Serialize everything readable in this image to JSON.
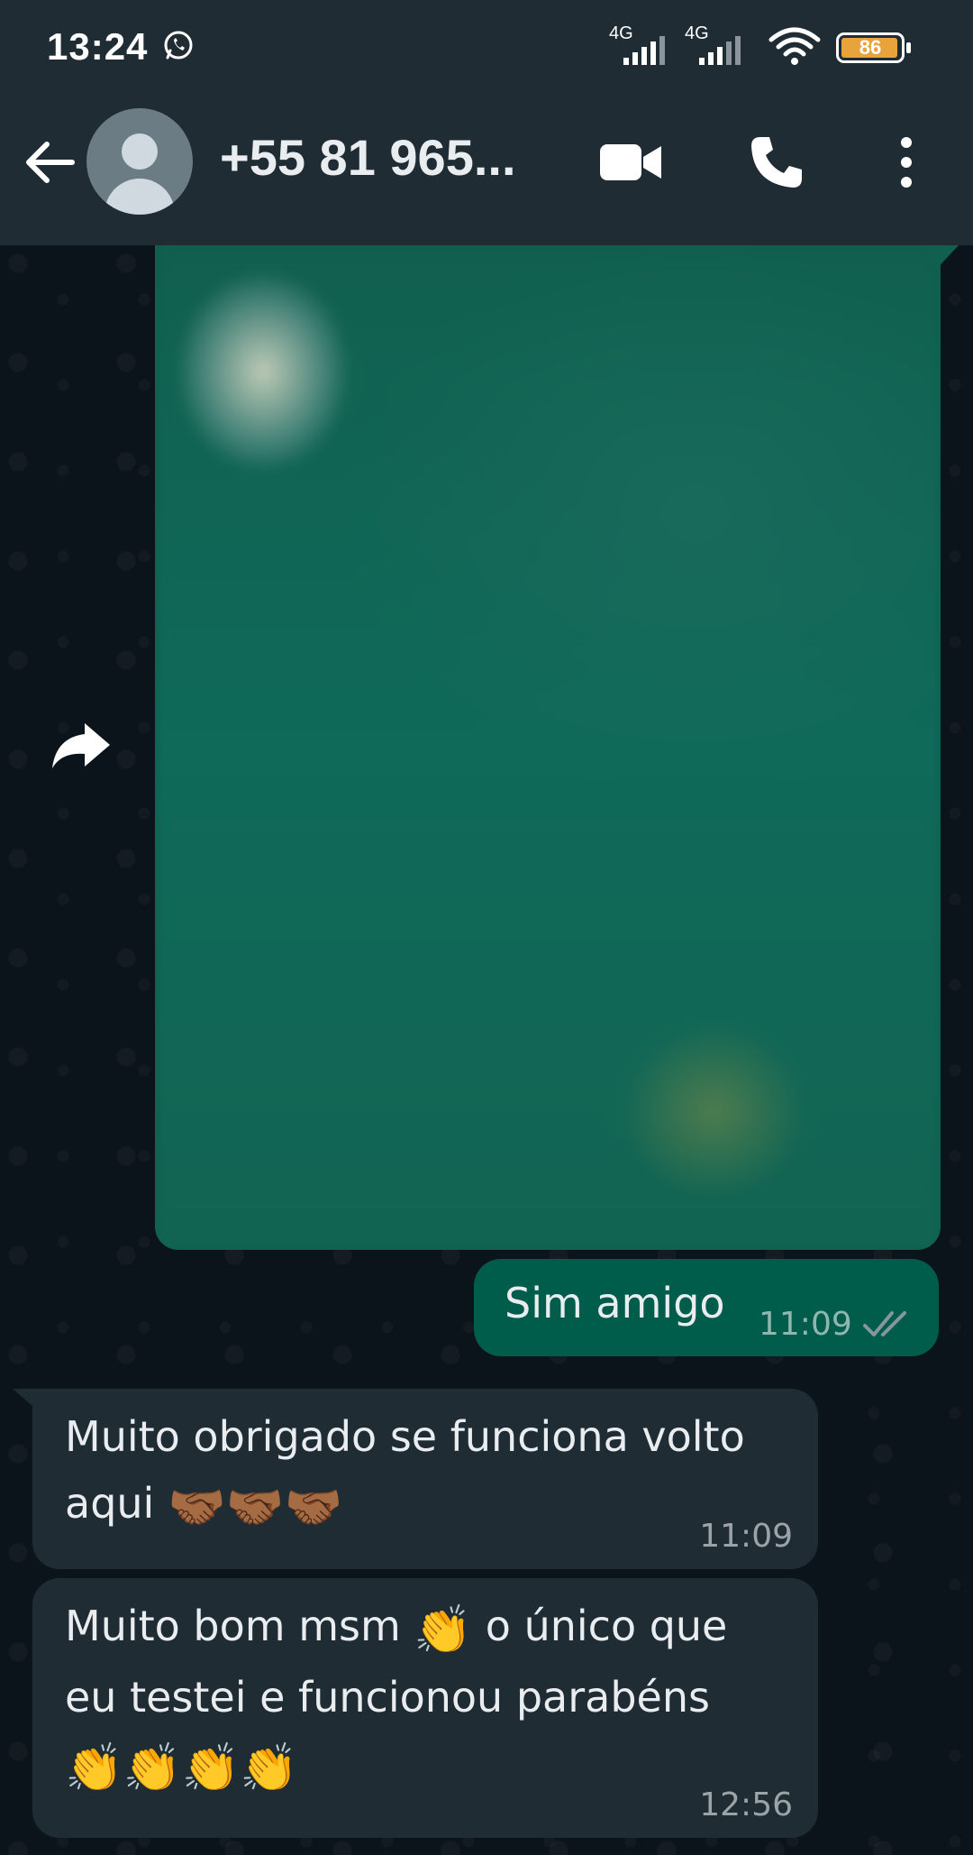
{
  "status_bar": {
    "time": "13:24",
    "signal1_label": "4G",
    "signal2_label": "4G",
    "battery_level": "86"
  },
  "header": {
    "contact_name": "+55 81 965..."
  },
  "messages": [
    {
      "type": "image",
      "direction": "outgoing"
    },
    {
      "type": "text",
      "direction": "outgoing",
      "text": "Sim amigo",
      "time": "11:09",
      "status": "read"
    },
    {
      "type": "text",
      "direction": "incoming",
      "text_line1": "Muito obrigado se funciona volto",
      "text_line2": "aqui",
      "emojis": "🤝🏾🤝🏾🤝🏾",
      "time": "11:09"
    },
    {
      "type": "text",
      "direction": "incoming",
      "text_part1": "Muito bom msm",
      "emoji1": "👏",
      "text_part2": "o único que",
      "text_line2": "eu testei e funcionou parabéns",
      "emojis_line3": "👏👏👏👏",
      "time": "12:56"
    }
  ],
  "colors": {
    "header_bg": "#1f2c34",
    "chat_bg": "#0b141a",
    "outgoing_bubble": "#005c4b",
    "incoming_bubble": "#1f2c34",
    "read_ticks": "#8696a0"
  }
}
